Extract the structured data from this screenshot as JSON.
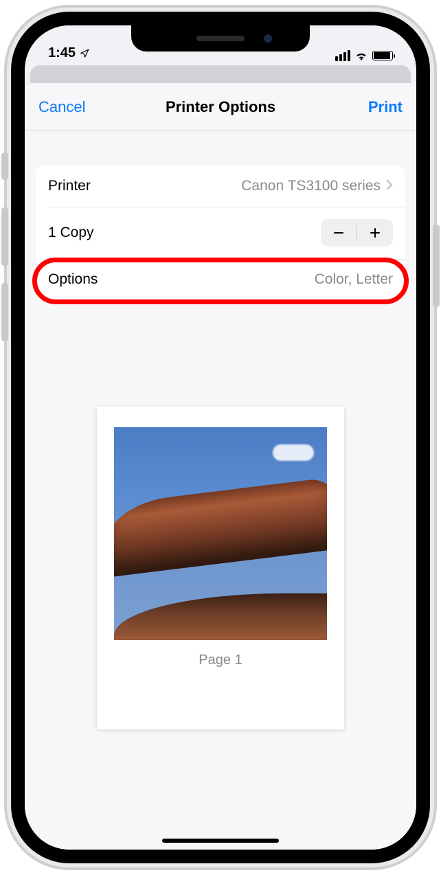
{
  "status": {
    "time": "1:45"
  },
  "nav": {
    "cancel": "Cancel",
    "title": "Printer Options",
    "print": "Print"
  },
  "rows": {
    "printer_label": "Printer",
    "printer_value": "Canon TS3100 series",
    "copies_label": "1 Copy",
    "options_label": "Options",
    "options_value": "Color, Letter"
  },
  "preview": {
    "page_label": "Page 1"
  }
}
